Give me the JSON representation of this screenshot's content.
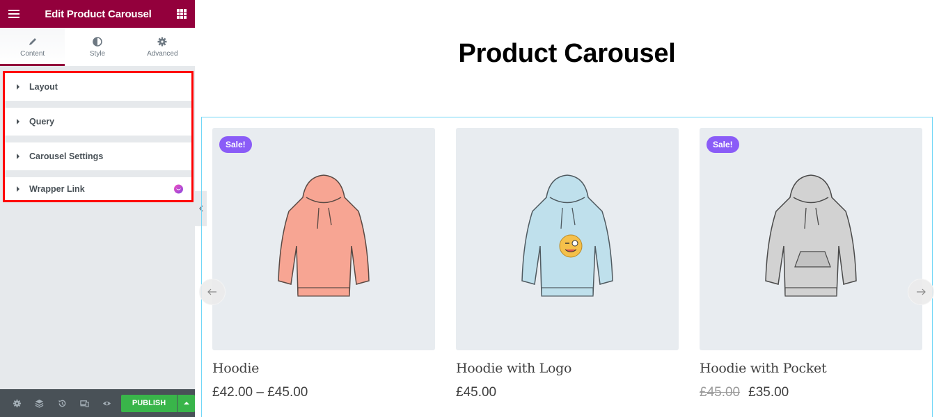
{
  "panel": {
    "title": "Edit Product Carousel",
    "tabs": [
      {
        "label": "Content",
        "icon": "pencil-icon",
        "active": true
      },
      {
        "label": "Style",
        "icon": "half-circle-icon",
        "active": false
      },
      {
        "label": "Advanced",
        "icon": "gear-icon",
        "active": false
      }
    ],
    "sections": [
      {
        "label": "Layout"
      },
      {
        "label": "Query"
      },
      {
        "label": "Carousel Settings"
      },
      {
        "label": "Wrapper Link",
        "badge": "pro-badge-icon"
      }
    ],
    "footer": {
      "icons": [
        "settings-icon",
        "navigator-layers-icon",
        "history-icon",
        "responsive-mode-icon",
        "preview-eye-icon"
      ],
      "publish_label": "PUBLISH"
    },
    "accent_color": "#93003c"
  },
  "page": {
    "title": "Product Carousel"
  },
  "products": [
    {
      "name": "Hoodie",
      "price": "£42.00 – £45.00",
      "old_price": null,
      "sale_badge": "Sale!",
      "color": "#f7a593"
    },
    {
      "name": "Hoodie with Logo",
      "price": "£45.00",
      "old_price": null,
      "sale_badge": null,
      "color": "#bfe0ec"
    },
    {
      "name": "Hoodie with Pocket",
      "price": "£35.00",
      "old_price": "£45.00",
      "sale_badge": "Sale!",
      "color": "#d2d2d2"
    }
  ],
  "colors": {
    "sale_badge": "#8a5cf7",
    "publish": "#39b54a",
    "selection_outline": "#ff0000"
  }
}
